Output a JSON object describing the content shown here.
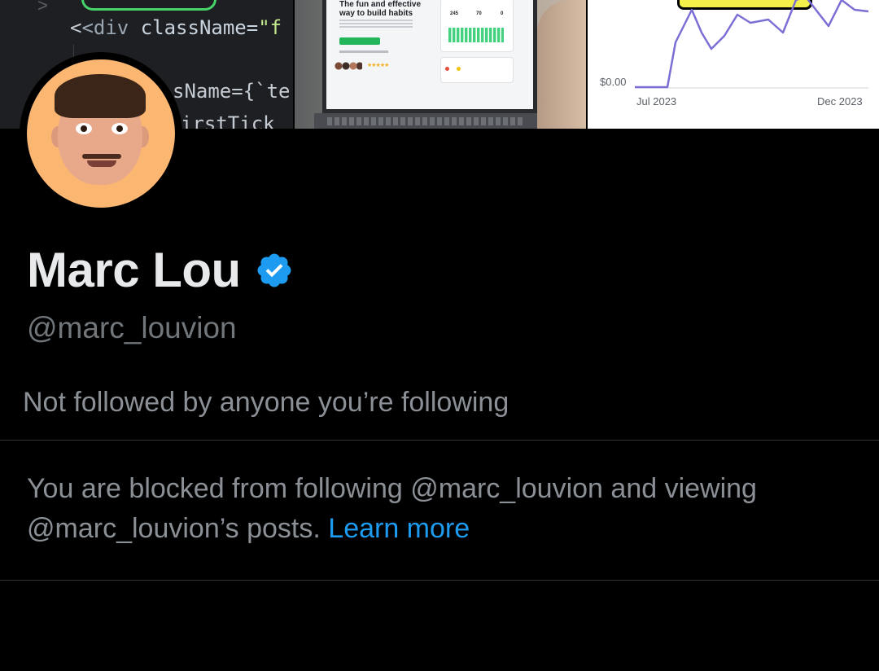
{
  "banner": {
    "code_panel": {
      "line1_tag": "<div ",
      "line1_attr": "className=",
      "line1_str": "\"f",
      "line2": "sName={`te",
      "line3": "irstTick"
    },
    "photo_panel": {
      "hero_title": "The fun and effective way to build habits",
      "stat1": "245",
      "stat2": "70",
      "stat3": "0",
      "stars": "★★★★★"
    },
    "chart_panel": {
      "y_label": "$0.00",
      "x_start": "Jul 2023",
      "x_end": "Dec 2023"
    }
  },
  "profile": {
    "display_name": "Marc Lou",
    "handle": "@marc_louvion",
    "followers_note": "Not followed by anyone you’re following",
    "blocked_message": "You are blocked from following @marc_louvion and viewing @marc_louvion’s posts.",
    "learn_more": "Learn more"
  },
  "colors": {
    "background": "#000000",
    "primary_text": "#e7e9ea",
    "secondary_text": "#71767b",
    "link": "#1d9bf0",
    "verified_badge": "#1d9bf0",
    "avatar_bg": "#fbb772",
    "chart_line": "#7b6fd6"
  },
  "icons": {
    "verified": "verified-badge-icon"
  }
}
